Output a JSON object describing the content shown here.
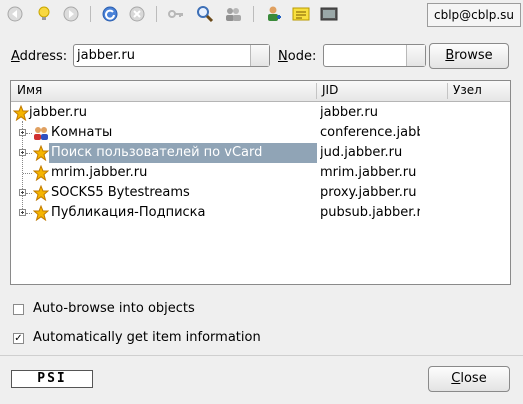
{
  "account": {
    "jid": "cblp@cblp.su"
  },
  "address": {
    "label": "Address:",
    "value": "jabber.ru"
  },
  "node": {
    "label": "Node:",
    "value": ""
  },
  "buttons": {
    "browse": "Browse",
    "close": "Close"
  },
  "list": {
    "headers": {
      "name": "Имя",
      "jid": "JID",
      "node": "Узел"
    },
    "root": {
      "name": "jabber.ru",
      "jid": "jabber.ru"
    },
    "items": [
      {
        "name": "Комнаты",
        "jid": "conference.jabbe…",
        "icon": "users-icon",
        "expandable": true
      },
      {
        "name": "Поиск пользователей по vCard",
        "jid": "jud.jabber.ru",
        "icon": "star-icon",
        "expandable": true,
        "selected": true
      },
      {
        "name": "mrim.jabber.ru",
        "jid": "mrim.jabber.ru",
        "icon": "star-icon",
        "expandable": false
      },
      {
        "name": "SOCKS5 Bytestreams",
        "jid": "proxy.jabber.ru",
        "icon": "star-icon",
        "expandable": true
      },
      {
        "name": "Публикация-Подписка",
        "jid": "pubsub.jabber.ru",
        "icon": "star-icon",
        "expandable": true
      }
    ]
  },
  "options": {
    "auto_browse": {
      "label": "Auto-browse into objects",
      "checked": false
    },
    "auto_info": {
      "label": "Automatically get item information",
      "checked": true,
      "mark": "✓"
    }
  },
  "footer": {
    "logo_text": "PSI"
  },
  "colors": {
    "selection": "#90a4b6",
    "star": "#f5b400"
  }
}
